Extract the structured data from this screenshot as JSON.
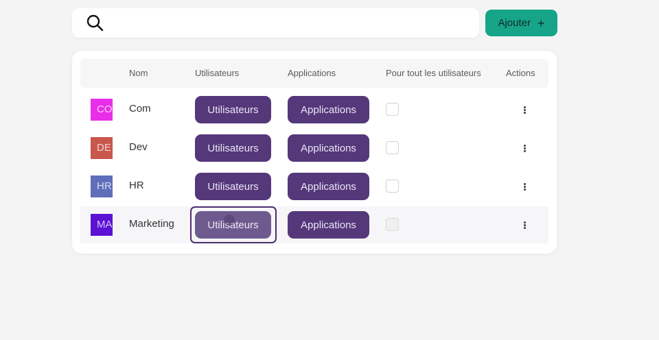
{
  "search": {
    "placeholder": ""
  },
  "toolbar": {
    "add_label": "Ajouter",
    "add_icon": "plus-icon"
  },
  "table": {
    "columns": [
      "Nom",
      "Utilisateurs",
      "Applications",
      "Pour tout les utilisateurs",
      "Actions"
    ],
    "rows": [
      {
        "initials": "CO",
        "color": "#e82ee8",
        "name": "Com",
        "users_label": "Utilisateurs",
        "apps_label": "Applications",
        "all_users": false
      },
      {
        "initials": "DE",
        "color": "#c8574e",
        "name": "Dev",
        "users_label": "Utilisateurs",
        "apps_label": "Applications",
        "all_users": false
      },
      {
        "initials": "HR",
        "color": "#5f6fba",
        "name": "HR",
        "users_label": "Utilisateurs",
        "apps_label": "Applications",
        "all_users": false
      },
      {
        "initials": "MA",
        "color": "#5b12d4",
        "name": "Marketing",
        "users_label": "Utilisateurs",
        "apps_label": "Applications",
        "all_users": false
      }
    ]
  },
  "colors": {
    "accent": "#17a589",
    "pill": "#54387a"
  }
}
